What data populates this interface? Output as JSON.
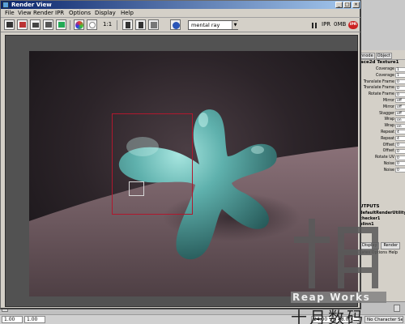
{
  "window": {
    "title": "Render View",
    "buttons": {
      "minimize": "_",
      "maximize": "□",
      "close": "×"
    }
  },
  "menu": [
    "File",
    "View",
    "Render",
    "IPR",
    "Options",
    "Display",
    "Help"
  ],
  "toolbar": {
    "ratio_label": "1:1",
    "renderer_value": "mental ray",
    "ipr_label": "IPR",
    "memory_label": "0MB",
    "ipr_badge": "IPR"
  },
  "attribute_editor": {
    "tabs": [
      "nnode",
      "Object"
    ],
    "node_name": "ace2d Texture1",
    "rows": [
      {
        "label": "Coverage",
        "value": "1"
      },
      {
        "label": "Coverage",
        "value": "1"
      },
      {
        "label": "Translate Frame",
        "value": "0"
      },
      {
        "label": "Translate Frame",
        "value": "0"
      },
      {
        "label": "Rotate Frame",
        "value": "0"
      },
      {
        "label": "Mirror",
        "value": "off"
      },
      {
        "label": "Mirror",
        "value": "off"
      },
      {
        "label": "Stagger",
        "value": "off"
      },
      {
        "label": "Wrap",
        "value": "on"
      },
      {
        "label": "Wrap",
        "value": "on"
      },
      {
        "label": "Repeat",
        "value": "4"
      },
      {
        "label": "Repeat",
        "value": "4"
      },
      {
        "label": "Offset",
        "value": "0"
      },
      {
        "label": "Offset",
        "value": "0"
      },
      {
        "label": "Rotate UV",
        "value": "0"
      },
      {
        "label": "Noise",
        "value": "0"
      },
      {
        "label": "Noise",
        "value": "0"
      }
    ],
    "outputs_title": "UTPUTS",
    "outputs": [
      "defaultRenderUtilityLi",
      "checker1",
      "blinn1"
    ],
    "buttons": [
      "Display",
      "Render"
    ],
    "subline": "lates  Options  Help"
  },
  "watermark": {
    "brand": "Reap Works",
    "chinese": "十月数码"
  },
  "range": {
    "start": "1.00",
    "current": "1.00",
    "end1": "24.00",
    "end2": "48.00",
    "character_set": "No Character Set"
  },
  "colors": {
    "titlebar_start": "#0a246a",
    "titlebar_end": "#a6caf0",
    "object_color": "#5fb1ad",
    "ipr_region": "#b0182e",
    "ipr_badge": "#cc2222"
  }
}
